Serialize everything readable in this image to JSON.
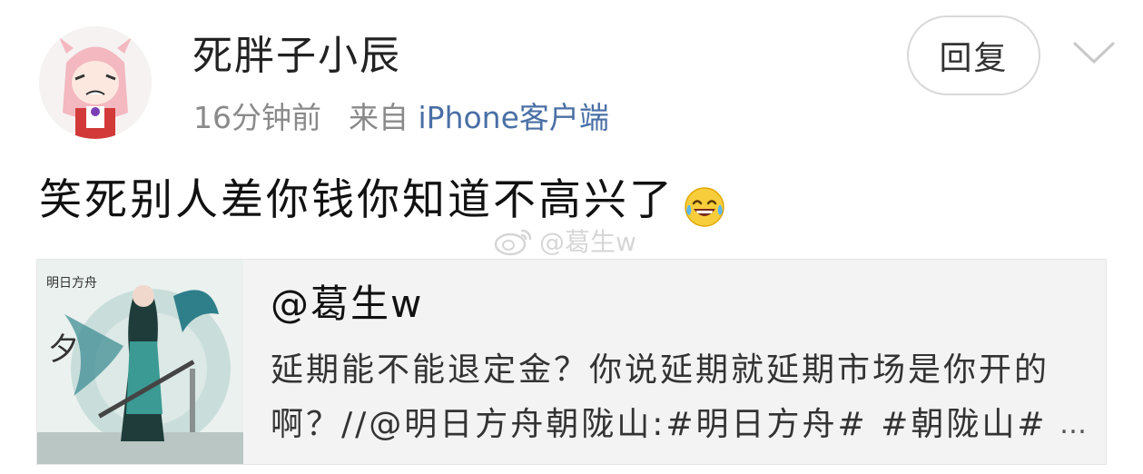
{
  "post": {
    "username": "死胖子小辰",
    "time": "16分钟前",
    "source_prefix": "来自",
    "source": "iPhone客户端",
    "reply_label": "回复",
    "text": "笑死别人差你钱你知道不高兴了",
    "emoji_icon": "laughing-tears-icon",
    "watermark": "@葛生w"
  },
  "quoted": {
    "author": "@葛生w",
    "line1": "延期能不能退定金？你说延期就延期市场是你开的",
    "line2": "啊？//@明日方舟朝陇山:#明日方舟# #朝陇山#",
    "ellipsis": "…",
    "thumb_brand": "明日方舟",
    "thumb_char": "夕"
  },
  "colors": {
    "link": "#4a6fa5",
    "meta": "#8a8a8a",
    "card_bg": "#f3f3f3"
  }
}
